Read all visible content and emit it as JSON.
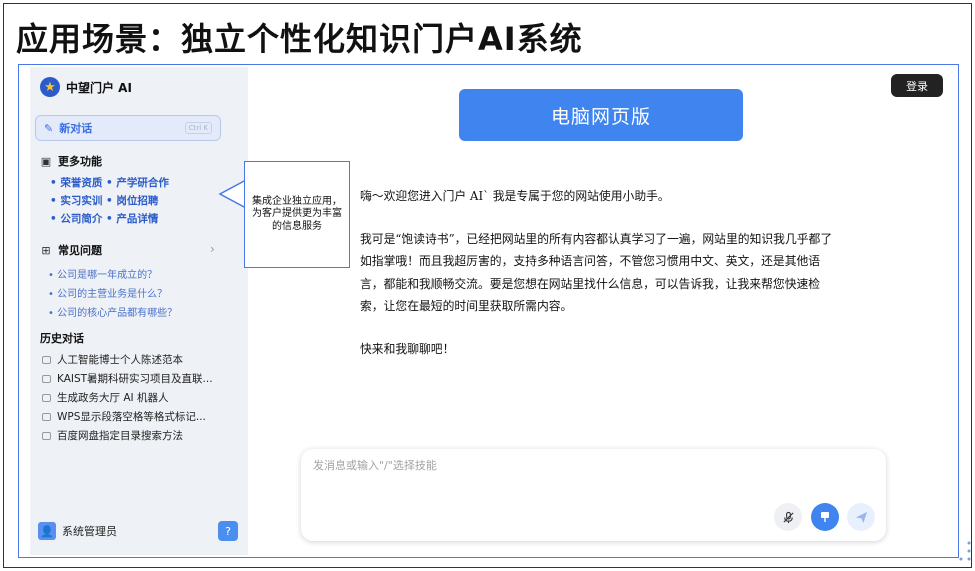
{
  "slide": {
    "title": "应用场景：独立个性化知识门户AI系统"
  },
  "brand": {
    "name": "中望门户 AI"
  },
  "sidebar": {
    "new_chat": {
      "label": "新对话",
      "shortcut": "Ctrl K"
    },
    "more_features": {
      "label": "更多功能",
      "rows": [
        "• 荣誉资质  • 产学研合作",
        "• 实习实训  • 岗位招聘",
        "• 公司简介  • 产品详情"
      ]
    },
    "faq": {
      "label": "常见问题",
      "items": [
        "• 公司是哪一年成立的？",
        "• 公司的主营业务是什么？",
        "• 公司的核心产品都有哪些？"
      ]
    },
    "history": {
      "label": "历史对话",
      "items": [
        "人工智能博士个人陈述范本",
        "KAIST暑期科研实习项目及直联...",
        "生成政务大厅 AI 机器人",
        "WPS显示段落空格等格式标记...",
        "百度网盘指定目录搜索方法"
      ]
    },
    "user": {
      "name": "系统管理员"
    }
  },
  "callout": {
    "text": "集成企业独立应用，为客户提供更为丰富的信息服务"
  },
  "header": {
    "login_label": "登录",
    "web_version_label": "电脑网页版"
  },
  "message": {
    "paragraphs": [
      "嗨～欢迎您进入门户 AI` 我是专属于您的网站使用小助手。",
      "我可是“饱读诗书”，已经把网站里的所有内容都认真学习了一遍，网站里的知识我几乎都了如指掌哦！而且我超厉害的，支持多种语言问答，不管您习惯用中文、英文，还是其他语言，都能和我顺畅交流。要是您想在网站里找什么信息，可以告诉我，让我来帮您快速检索，让您在最短的时间里获取所需内容。",
      "快来和我聊聊吧！"
    ]
  },
  "composer": {
    "placeholder": "发消息或输入\"/\"选择技能"
  },
  "icons": {
    "brand": "star-badge-icon",
    "new_chat": "edit-icon",
    "more": "image-icon",
    "faq": "grid-icon",
    "chevron": "chevron-right-icon",
    "history": "chat-bubble-icon",
    "user": "user-icon",
    "help": "help-icon",
    "mic": "mic-off-icon",
    "record": "record-icon",
    "send": "send-icon"
  },
  "colors": {
    "accent": "#3f84ef",
    "frame": "#4a78e8",
    "sidebar_bg": "#eef1f6",
    "link": "#2b5cc9"
  }
}
